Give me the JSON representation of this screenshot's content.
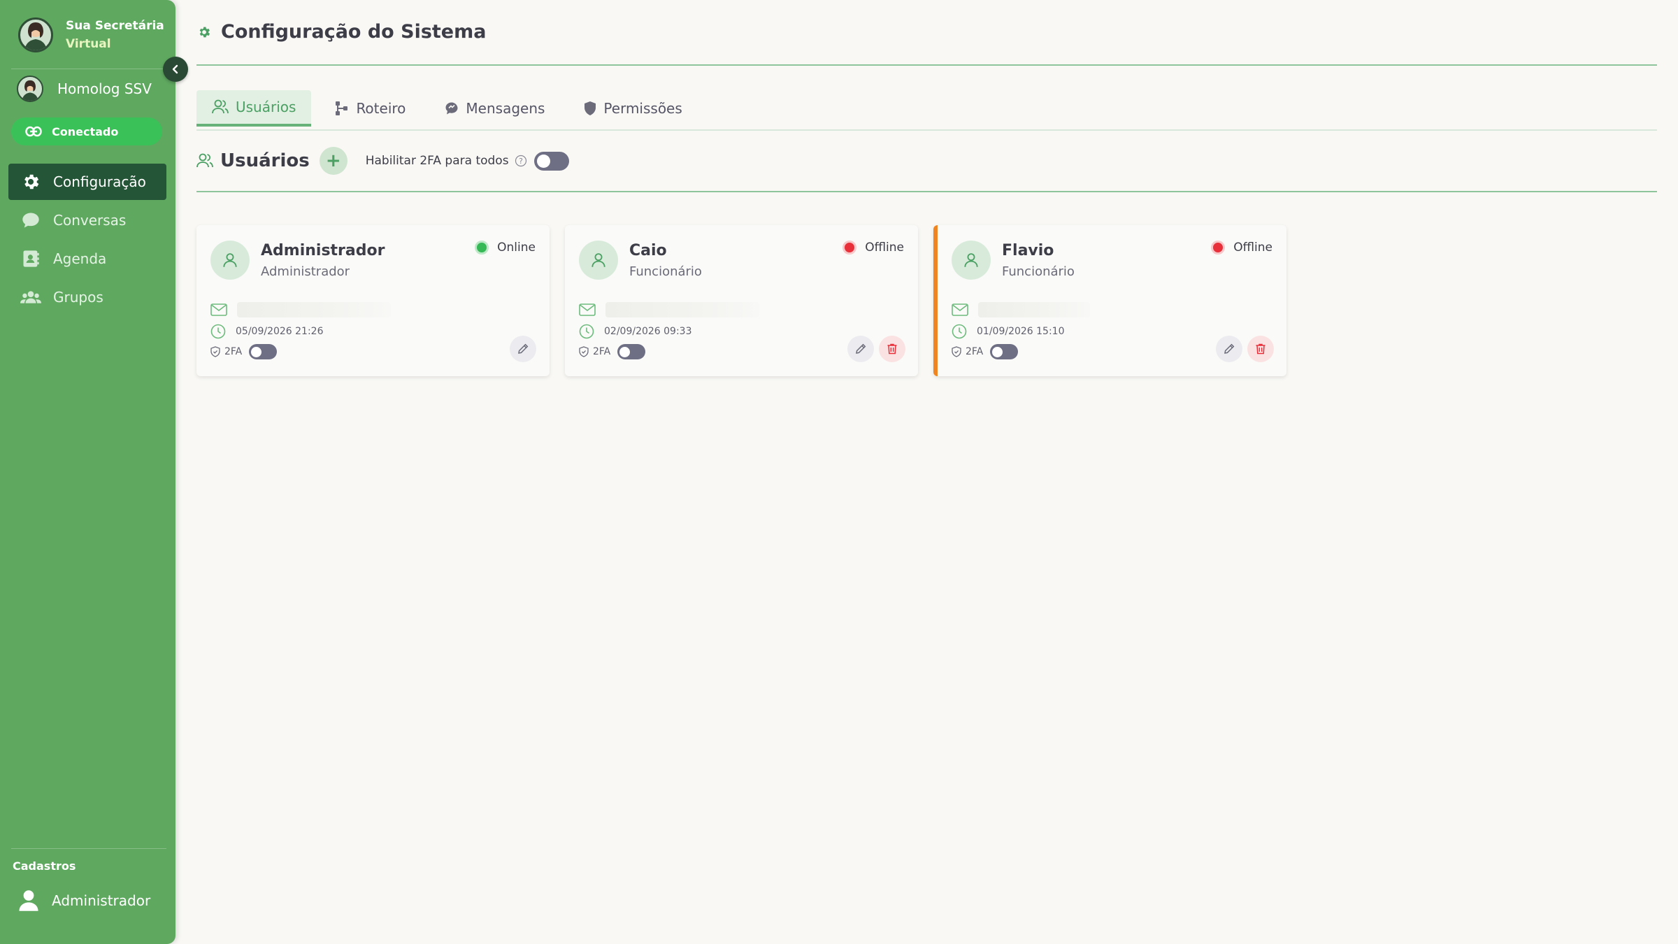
{
  "sidebar": {
    "brand_line1": "Sua Secretária",
    "brand_line2": "Virtual",
    "account_name": "Homolog SSV",
    "status_label": "Conectado",
    "items": [
      {
        "label": "Configuração",
        "icon": "gear-icon",
        "active": true
      },
      {
        "label": "Conversas",
        "icon": "chat-bubble-icon",
        "active": false
      },
      {
        "label": "Agenda",
        "icon": "contact-book-icon",
        "active": false
      },
      {
        "label": "Grupos",
        "icon": "group-icon",
        "active": false
      }
    ],
    "section_title": "Cadastros",
    "bottom_user": "Administrador"
  },
  "page": {
    "title": "Configuração do Sistema"
  },
  "tabs": [
    {
      "label": "Usuários",
      "icon": "users-icon",
      "active": true
    },
    {
      "label": "Roteiro",
      "icon": "flow-icon",
      "active": false
    },
    {
      "label": "Mensagens",
      "icon": "message-icon",
      "active": false
    },
    {
      "label": "Permissões",
      "icon": "shield-icon",
      "active": false
    }
  ],
  "users_section": {
    "title": "Usuários",
    "add_label": "+",
    "twofa_all_label": "Habilitar 2FA para todos",
    "twofa_all_enabled": false
  },
  "users": [
    {
      "name": "Administrador",
      "role": "Administrador",
      "status": "Online",
      "last_access": "05/09/2026 21:26",
      "twofa_label": "2FA",
      "twofa_enabled": false,
      "can_delete": false,
      "highlighted": false
    },
    {
      "name": "Caio",
      "role": "Funcionário",
      "status": "Offline",
      "last_access": "02/09/2026 09:33",
      "twofa_label": "2FA",
      "twofa_enabled": false,
      "can_delete": true,
      "highlighted": false
    },
    {
      "name": "Flavio",
      "role": "Funcionário",
      "status": "Offline",
      "last_access": "01/09/2026 15:10",
      "twofa_label": "2FA",
      "twofa_enabled": false,
      "can_delete": true,
      "highlighted": true
    }
  ],
  "colors": {
    "sidebar": "#5fa860",
    "sidebar_active": "#245537",
    "connected": "#3ac259",
    "accent_green": "#4ba063",
    "online": "#35b956",
    "offline": "#e8303a",
    "highlight": "#f08421"
  }
}
